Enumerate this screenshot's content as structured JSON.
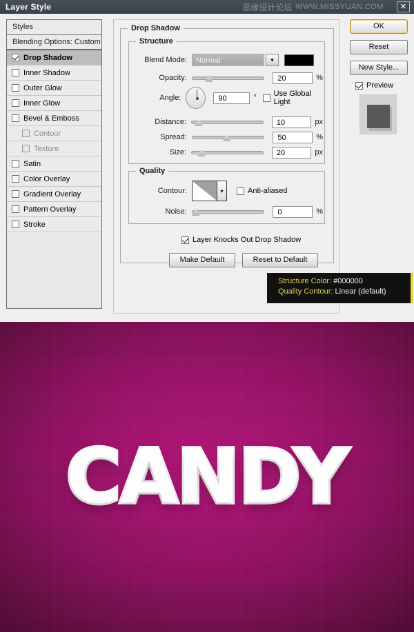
{
  "window": {
    "title": "Layer Style",
    "watermark_cn": "思缘设计论坛",
    "watermark_url": "WWW.MISSYUAN.COM",
    "close_icon": "✕"
  },
  "styles_panel": {
    "header": "Styles",
    "blending_options": "Blending Options: Custom",
    "effects": [
      {
        "label": "Drop Shadow",
        "checked": true,
        "selected": true,
        "sub": false,
        "dim": false
      },
      {
        "label": "Inner Shadow",
        "checked": false,
        "selected": false,
        "sub": false,
        "dim": false
      },
      {
        "label": "Outer Glow",
        "checked": false,
        "selected": false,
        "sub": false,
        "dim": false
      },
      {
        "label": "Inner Glow",
        "checked": false,
        "selected": false,
        "sub": false,
        "dim": false
      },
      {
        "label": "Bevel & Emboss",
        "checked": false,
        "selected": false,
        "sub": false,
        "dim": false
      },
      {
        "label": "Contour",
        "checked": false,
        "selected": false,
        "sub": true,
        "dim": true
      },
      {
        "label": "Texture",
        "checked": false,
        "selected": false,
        "sub": true,
        "dim": true
      },
      {
        "label": "Satin",
        "checked": false,
        "selected": false,
        "sub": false,
        "dim": false
      },
      {
        "label": "Color Overlay",
        "checked": false,
        "selected": false,
        "sub": false,
        "dim": false
      },
      {
        "label": "Gradient Overlay",
        "checked": false,
        "selected": false,
        "sub": false,
        "dim": false
      },
      {
        "label": "Pattern Overlay",
        "checked": false,
        "selected": false,
        "sub": false,
        "dim": false
      },
      {
        "label": "Stroke",
        "checked": false,
        "selected": false,
        "sub": false,
        "dim": false
      }
    ]
  },
  "main": {
    "group_title": "Drop Shadow",
    "structure": {
      "legend": "Structure",
      "blend_mode_label": "Blend Mode:",
      "blend_mode_value": "Normal",
      "dropdown_arrow": "▾",
      "color_swatch": "#000000",
      "opacity_label": "Opacity:",
      "opacity_value": "20",
      "opacity_unit": "%",
      "angle_label": "Angle:",
      "angle_value": "90",
      "angle_unit": "°",
      "use_global_light": "Use Global Light",
      "use_global_light_checked": false,
      "distance_label": "Distance:",
      "distance_value": "10",
      "distance_unit": "px",
      "spread_label": "Spread:",
      "spread_value": "50",
      "spread_unit": "%",
      "size_label": "Size:",
      "size_value": "20",
      "size_unit": "px"
    },
    "quality": {
      "legend": "Quality",
      "contour_label": "Contour:",
      "contour_arrow": "▾",
      "anti_aliased": "Anti-aliased",
      "anti_aliased_checked": false,
      "noise_label": "Noise:",
      "noise_value": "0",
      "noise_unit": "%"
    },
    "knocks_out_label": "Layer Knocks Out Drop Shadow",
    "knocks_out_checked": true,
    "make_default": "Make Default",
    "reset_to_default": "Reset to Default"
  },
  "right_panel": {
    "ok": "OK",
    "reset": "Reset",
    "new_style": "New Style...",
    "preview": "Preview",
    "preview_checked": true
  },
  "tooltip": {
    "line1_key": "Structure Color:",
    "line1_value": "#000000",
    "line2_key": "Quality Contour:",
    "line2_value": "Linear (default)",
    "accent_color": "#e8d44a"
  },
  "artwork": {
    "text": "CANDY",
    "text_color": "#fdfdfd",
    "background_center": "#b01678",
    "background_edge": "#530c37"
  }
}
